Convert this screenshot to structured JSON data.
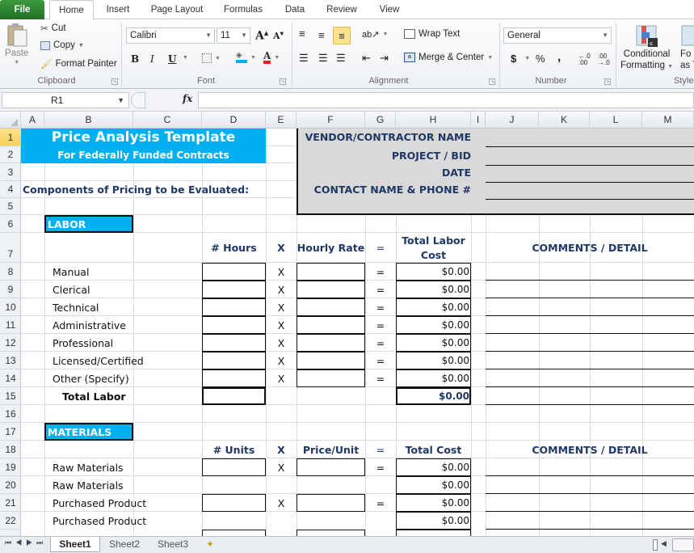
{
  "ribbon_tabs": [
    "File",
    "Home",
    "Insert",
    "Page Layout",
    "Formulas",
    "Data",
    "Review",
    "View"
  ],
  "active_tab": "Home",
  "clipboard": {
    "paste": "Paste",
    "cut": "Cut",
    "copy": "Copy",
    "format_painter": "Format Painter",
    "group": "Clipboard"
  },
  "font": {
    "name": "Calibri",
    "size": "11",
    "bold": "B",
    "italic": "I",
    "underline": "U",
    "group": "Font"
  },
  "alignment": {
    "wrap": "Wrap Text",
    "merge": "Merge & Center",
    "group": "Alignment"
  },
  "number": {
    "format": "General",
    "currency": "$",
    "percent": "%",
    "comma": ",",
    "inc_dec": ".0 .00",
    "group": "Number"
  },
  "styles": {
    "cond_line1": "Conditional",
    "cond_line2": "Formatting",
    "format_table_line1": "Fo",
    "format_table_line2": "as T",
    "group": "Style"
  },
  "formula_bar": {
    "name_box": "R1",
    "fx": "fx",
    "formula": ""
  },
  "columns": [
    "A",
    "B",
    "C",
    "D",
    "E",
    "F",
    "G",
    "H",
    "I",
    "J",
    "K",
    "L",
    "M"
  ],
  "rows": [
    "1",
    "2",
    "3",
    "4",
    "5",
    "6",
    "7",
    "8",
    "9",
    "10",
    "11",
    "12",
    "13",
    "14",
    "15",
    "16",
    "17",
    "18",
    "19",
    "20",
    "21",
    "22"
  ],
  "selected_row": "1",
  "sheet": {
    "title": "Price Analysis Template",
    "subtitle": "For Federally Funded Contracts",
    "components_label": "Components of Pricing to be Evaluated:",
    "info_fields": [
      "VENDOR/CONTRACTOR NAME",
      "PROJECT / BID",
      "DATE",
      "CONTACT NAME & PHONE #"
    ],
    "labor": {
      "section": "LABOR",
      "headers": {
        "qty": "# Hours",
        "times": "X",
        "rate": "Hourly Rate",
        "eq": "=",
        "total_line1": "Total Labor",
        "total_line2": "Cost",
        "comments": "COMMENTS / DETAIL"
      },
      "items": [
        {
          "label": "Manual",
          "op": "X",
          "eq": "=",
          "total": "$0.00"
        },
        {
          "label": "Clerical",
          "op": "X",
          "eq": "=",
          "total": "$0.00"
        },
        {
          "label": "Technical",
          "op": "X",
          "eq": "=",
          "total": "$0.00"
        },
        {
          "label": "Administrative",
          "op": "X",
          "eq": "=",
          "total": "$0.00"
        },
        {
          "label": "Professional",
          "op": "X",
          "eq": "=",
          "total": "$0.00"
        },
        {
          "label": "Licensed/Certified",
          "op": "X",
          "eq": "=",
          "total": "$0.00"
        },
        {
          "label": "Other (Specify)",
          "op": "X",
          "eq": "=",
          "total": "$0.00"
        }
      ],
      "total_label": "Total Labor",
      "total_value": "$0.00"
    },
    "materials": {
      "section": "MATERIALS",
      "headers": {
        "qty": "# Units",
        "times": "X",
        "rate": "Price/Unit",
        "eq": "=",
        "total": "Total Cost",
        "comments": "COMMENTS / DETAIL"
      },
      "items": [
        {
          "label": "Raw Materials",
          "op": "X",
          "eq": "=",
          "total": "$0.00"
        },
        {
          "label": "Raw Materials",
          "op": "",
          "eq": "",
          "total": "$0.00"
        },
        {
          "label": "Purchased Product",
          "op": "X",
          "eq": "=",
          "total": "$0.00"
        },
        {
          "label": "Purchased Product",
          "op": "",
          "eq": "",
          "total": "$0.00"
        }
      ]
    }
  },
  "sheet_tabs": [
    "Sheet1",
    "Sheet2",
    "Sheet3"
  ],
  "active_sheet": "Sheet1",
  "colors": {
    "accent_blue": "#00b0f0",
    "navy": "#1f3864",
    "info_gray": "#d9d9d9",
    "file_green": "#217024"
  }
}
